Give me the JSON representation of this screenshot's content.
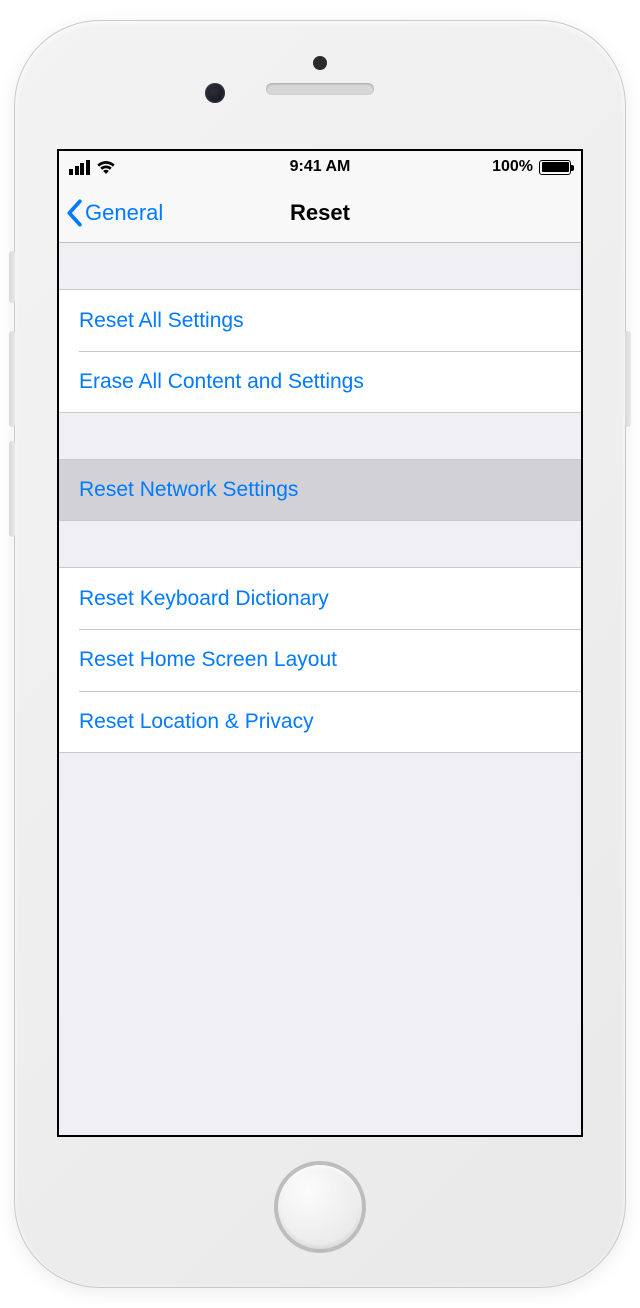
{
  "status_bar": {
    "time": "9:41 AM",
    "battery_pct": "100%"
  },
  "nav": {
    "back_label": "General",
    "title": "Reset"
  },
  "groups": [
    {
      "items": [
        {
          "label": "Reset All Settings",
          "selected": false
        },
        {
          "label": "Erase All Content and Settings",
          "selected": false
        }
      ]
    },
    {
      "items": [
        {
          "label": "Reset Network Settings",
          "selected": true
        }
      ]
    },
    {
      "items": [
        {
          "label": "Reset Keyboard Dictionary",
          "selected": false
        },
        {
          "label": "Reset Home Screen Layout",
          "selected": false
        },
        {
          "label": "Reset Location & Privacy",
          "selected": false
        }
      ]
    }
  ]
}
